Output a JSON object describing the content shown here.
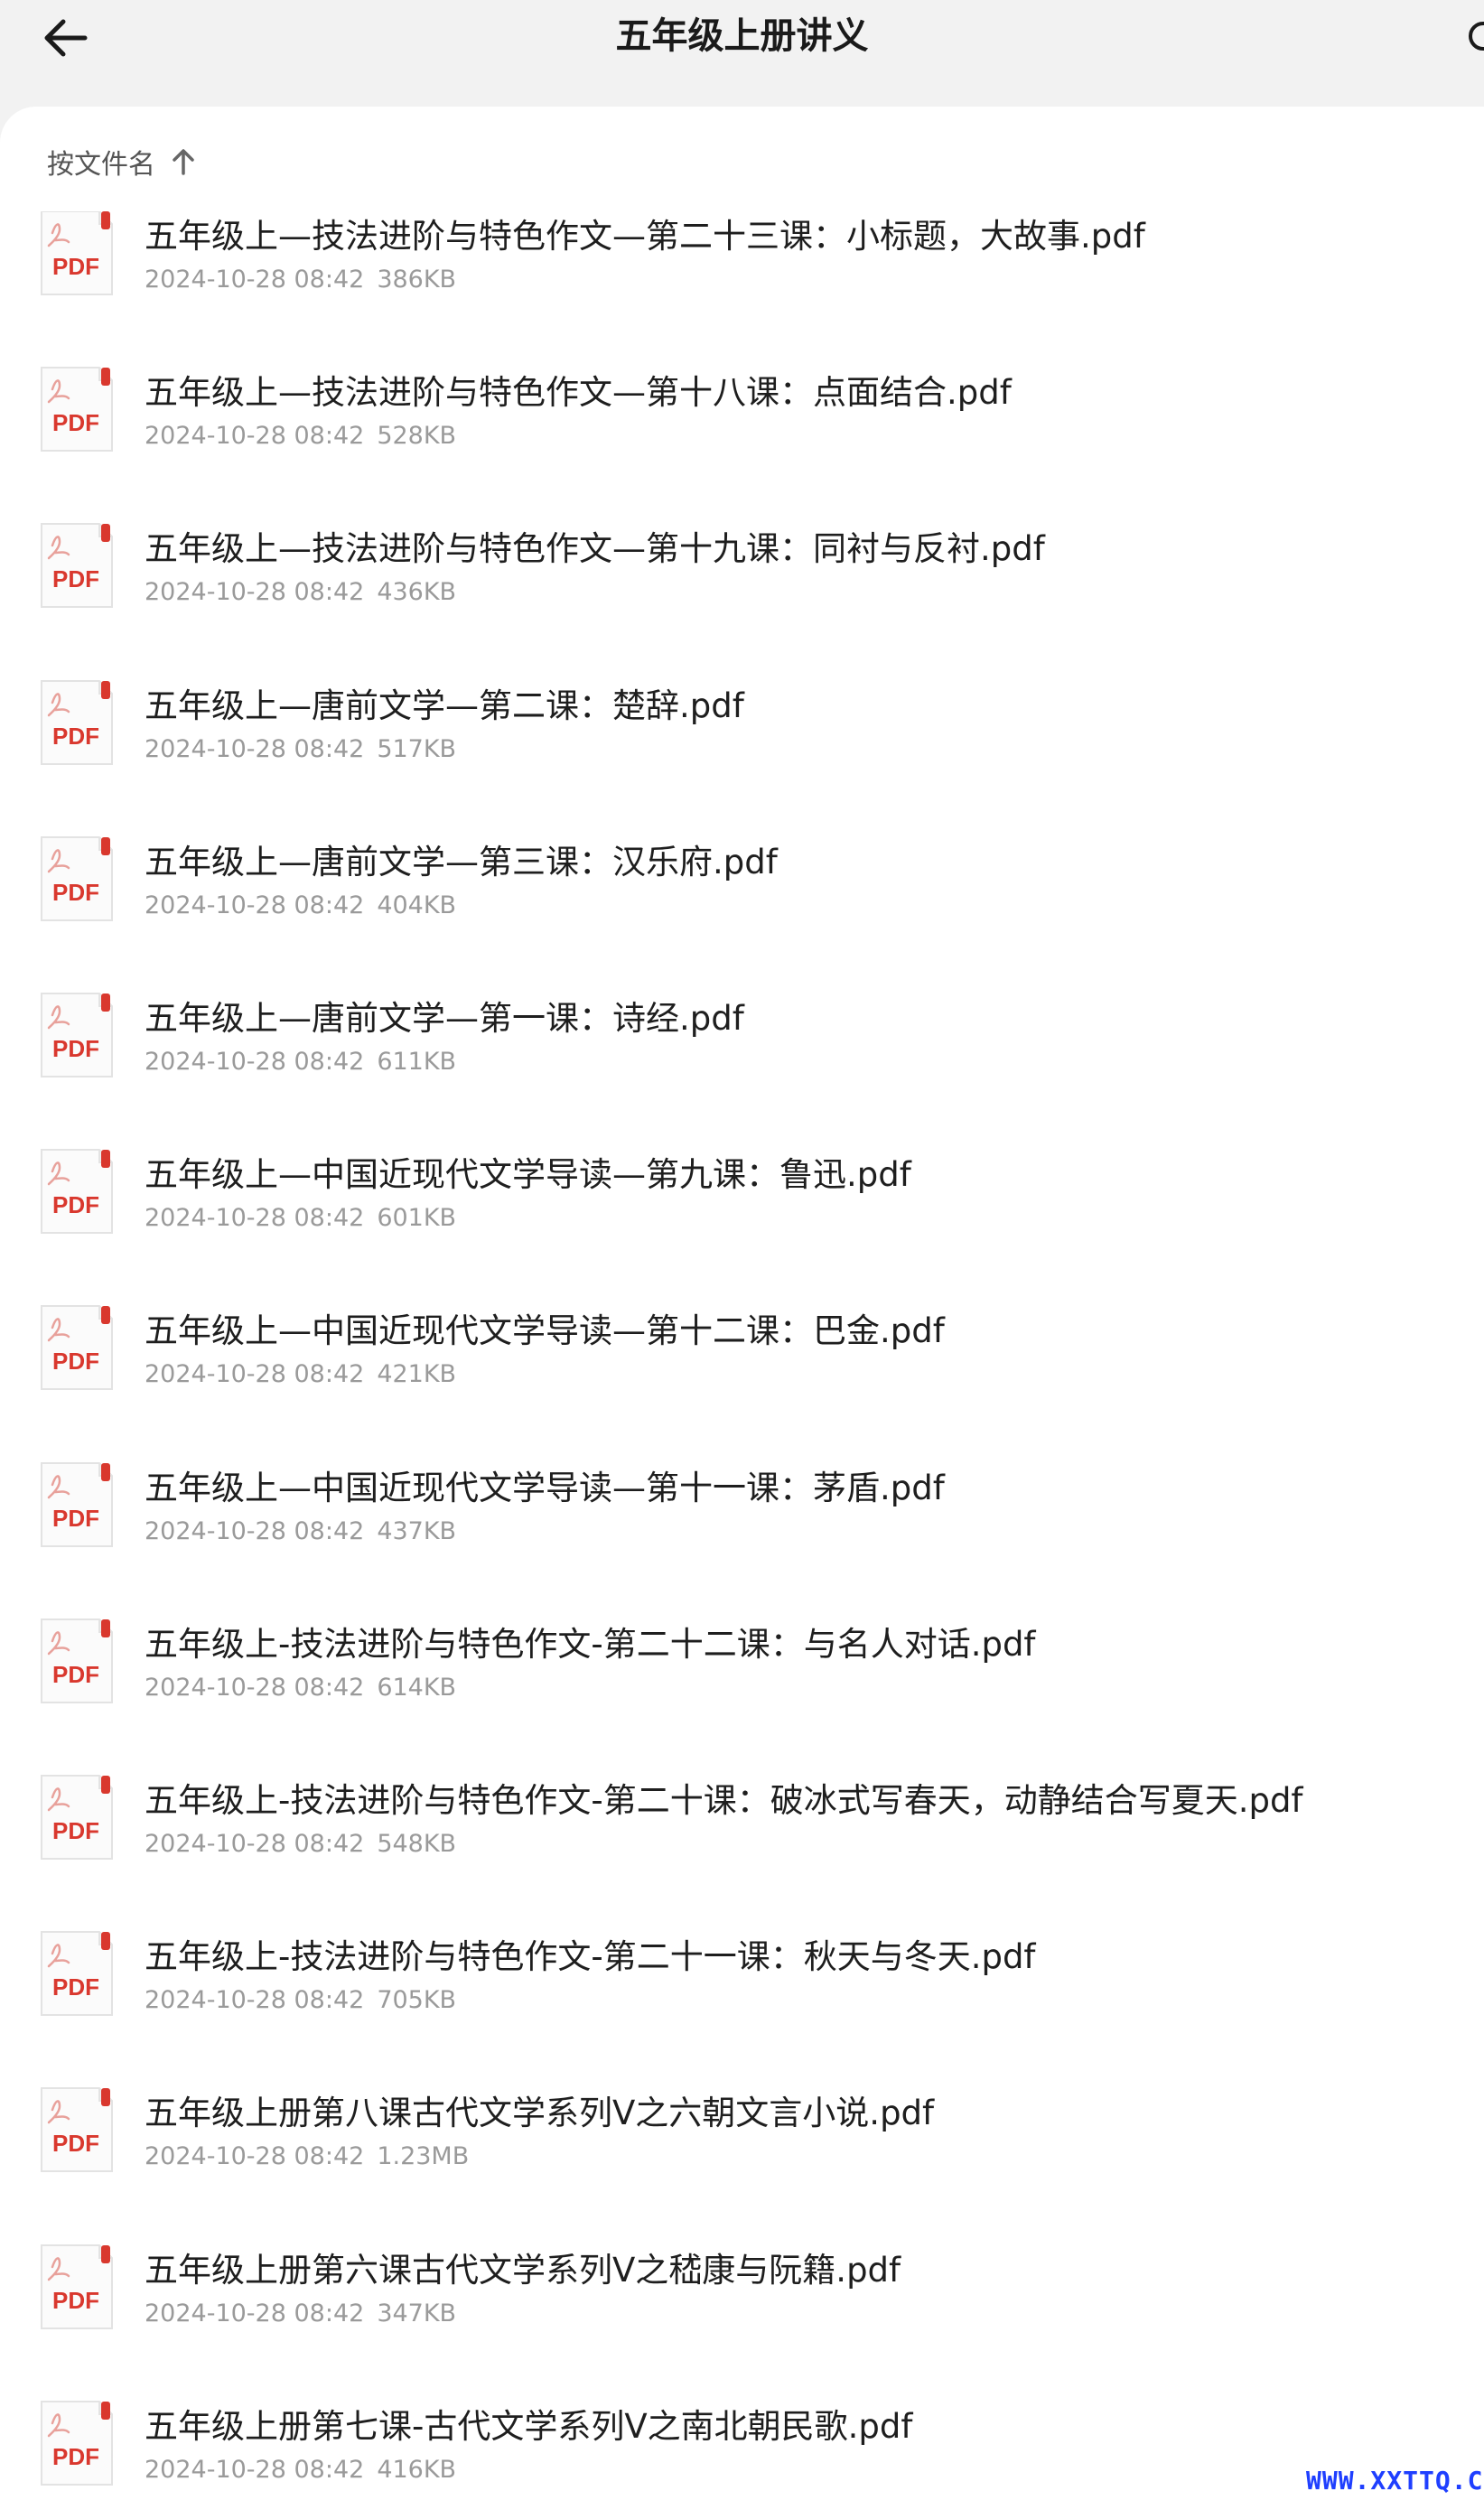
{
  "header": {
    "title": "五年级上册讲义",
    "back_icon": "arrow-left-icon",
    "search_icon": "search-icon"
  },
  "sort": {
    "label": "按文件名",
    "direction_icon": "arrow-up-icon"
  },
  "colors": {
    "pdf_red": "#d9382e",
    "accent_blue": "#1f3fff"
  },
  "file_icon_label": "PDF",
  "files": [
    {
      "name": "五年级上—技法进阶与特色作文—第二十三课：小标题，大故事.pdf",
      "date": "2024-10-28 08:42",
      "size": "386KB"
    },
    {
      "name": "五年级上—技法进阶与特色作文—第十八课：点面结合.pdf",
      "date": "2024-10-28 08:42",
      "size": "528KB"
    },
    {
      "name": "五年级上—技法进阶与特色作文—第十九课：同衬与反衬.pdf",
      "date": "2024-10-28 08:42",
      "size": "436KB"
    },
    {
      "name": "五年级上—唐前文学—第二课：楚辞.pdf",
      "date": "2024-10-28 08:42",
      "size": "517KB"
    },
    {
      "name": "五年级上—唐前文学—第三课：汉乐府.pdf",
      "date": "2024-10-28 08:42",
      "size": "404KB"
    },
    {
      "name": "五年级上—唐前文学—第一课：诗经.pdf",
      "date": "2024-10-28 08:42",
      "size": "611KB"
    },
    {
      "name": "五年级上—中国近现代文学导读—第九课：鲁迅.pdf",
      "date": "2024-10-28 08:42",
      "size": "601KB"
    },
    {
      "name": "五年级上—中国近现代文学导读—第十二课：巴金.pdf",
      "date": "2024-10-28 08:42",
      "size": "421KB"
    },
    {
      "name": "五年级上—中国近现代文学导读—第十一课：茅盾.pdf",
      "date": "2024-10-28 08:42",
      "size": "437KB"
    },
    {
      "name": "五年级上-技法进阶与特色作文-第二十二课：与名人对话.pdf",
      "date": "2024-10-28 08:42",
      "size": "614KB"
    },
    {
      "name": "五年级上-技法进阶与特色作文-第二十课：破冰式写春天，动静结合写夏天.pdf",
      "date": "2024-10-28 08:42",
      "size": "548KB"
    },
    {
      "name": "五年级上-技法进阶与特色作文-第二十一课：秋天与冬天.pdf",
      "date": "2024-10-28 08:42",
      "size": "705KB"
    },
    {
      "name": "五年级上册第八课古代文学系列V之六朝文言小说.pdf",
      "date": "2024-10-28 08:42",
      "size": "1.23MB"
    },
    {
      "name": "五年级上册第六课古代文学系列V之嵇康与阮籍.pdf",
      "date": "2024-10-28 08:42",
      "size": "347KB"
    },
    {
      "name": "五年级上册第七课-古代文学系列V之南北朝民歌.pdf",
      "date": "2024-10-28 08:42",
      "size": "416KB"
    }
  ],
  "watermark": "WWW.XXTTQ.COM"
}
